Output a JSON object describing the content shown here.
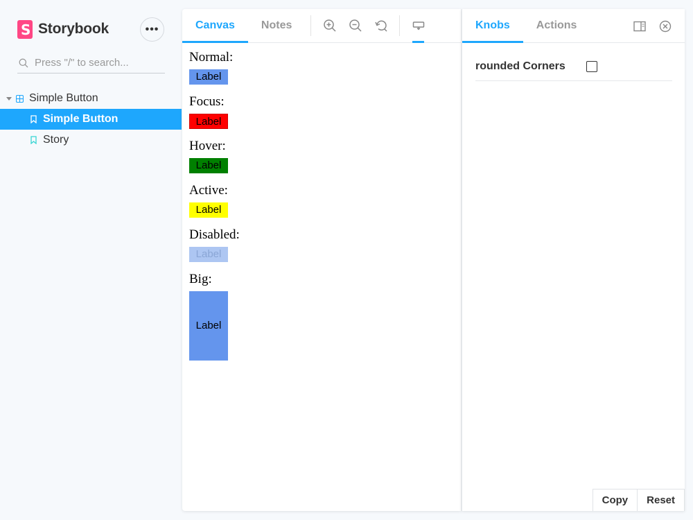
{
  "app": {
    "name": "Storybook",
    "brand_color": "#FF4785",
    "accent_color": "#1EA7FD"
  },
  "sidebar": {
    "menu_label": "•••",
    "search": {
      "placeholder": "Press \"/\" to search...",
      "icon": "search-icon"
    },
    "tree": {
      "group": {
        "label": "Simple Button",
        "icon": "component-icon",
        "expanded": true
      },
      "stories": [
        {
          "label": "Simple Button",
          "icon": "bookmark-icon",
          "selected": true
        },
        {
          "label": "Story",
          "icon": "bookmark-icon",
          "selected": false
        }
      ]
    }
  },
  "main": {
    "tabs": [
      {
        "label": "Canvas",
        "active": true
      },
      {
        "label": "Notes",
        "active": false
      }
    ],
    "tools": [
      "zoom-in-icon",
      "zoom-out-icon",
      "reset-zoom-icon",
      "viewport-icon"
    ],
    "demos": [
      {
        "heading": "Normal:",
        "button": "Label",
        "state": "normal",
        "color": "#6495ED"
      },
      {
        "heading": "Focus:",
        "button": "Label",
        "state": "focus",
        "color": "#FF0000"
      },
      {
        "heading": "Hover:",
        "button": "Label",
        "state": "hover",
        "color": "#008000"
      },
      {
        "heading": "Active:",
        "button": "Label",
        "state": "active",
        "color": "#FFFF00"
      },
      {
        "heading": "Disabled:",
        "button": "Label",
        "state": "disabled",
        "color": "#ADC6F2"
      },
      {
        "heading": "Big:",
        "button": "Label",
        "state": "big",
        "color": "#6495ED"
      }
    ]
  },
  "addons": {
    "tabs": [
      {
        "label": "Knobs",
        "active": true
      },
      {
        "label": "Actions",
        "active": false
      }
    ],
    "icons": [
      "panel-orientation-icon",
      "close-icon"
    ],
    "knobs": [
      {
        "label": "rounded Corners",
        "type": "boolean",
        "value": false
      }
    ],
    "footer": {
      "copy_label": "Copy",
      "reset_label": "Reset"
    }
  }
}
